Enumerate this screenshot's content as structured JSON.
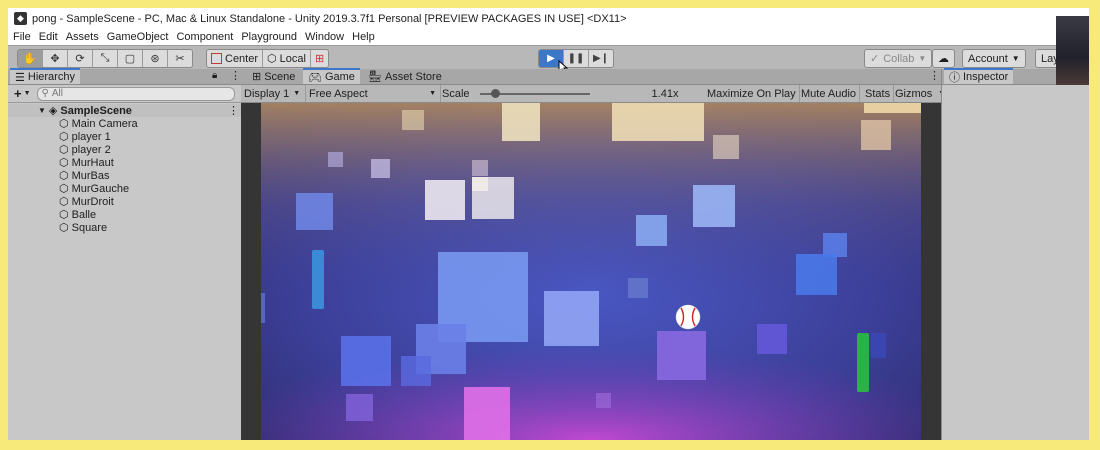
{
  "window": {
    "title": "pong - SampleScene - PC, Mac & Linux Standalone - Unity 2019.3.7f1 Personal [PREVIEW PACKAGES IN USE] <DX11>"
  },
  "menu": [
    "File",
    "Edit",
    "Assets",
    "GameObject",
    "Component",
    "Playground",
    "Window",
    "Help"
  ],
  "toolbar": {
    "pivot_label": "Center",
    "rotation_label": "Local",
    "collab_label": "Collab",
    "account_label": "Account",
    "layout_label": "Lay"
  },
  "tabs": {
    "hierarchy": "Hierarchy",
    "scene": "Scene",
    "game": "Game",
    "asset_store": "Asset Store",
    "inspector": "Inspector"
  },
  "hierarchy": {
    "search_placeholder": "All",
    "scene_name": "SampleScene",
    "items": [
      "Main Camera",
      "player 1",
      "player 2",
      "MurHaut",
      "MurBas",
      "MurGauche",
      "MurDroit",
      "Balle",
      "Square"
    ]
  },
  "game_toolbar": {
    "display": "Display 1",
    "aspect": "Free Aspect",
    "scale_label": "Scale",
    "scale_value": "1.41x",
    "scale_level": 0.1,
    "maximize": "Maximize On Play",
    "mute": "Mute Audio",
    "stats": "Stats",
    "gizmos": "Gizmos"
  },
  "game_view": {
    "play_state": "playing",
    "paddle_left_color": "#3a8ad6",
    "paddle_right_color": "#2bb04a",
    "ball_icon": "baseball-icon"
  },
  "colors": {
    "accent": "#3c78c8",
    "frame_border": "#f7ea7a"
  }
}
